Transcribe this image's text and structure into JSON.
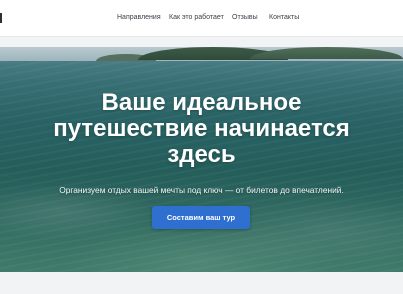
{
  "header": {
    "nav": [
      {
        "label": "Направления"
      },
      {
        "label": "Как это работает"
      },
      {
        "label": "Отзывы"
      },
      {
        "label": "Контакты"
      }
    ]
  },
  "hero": {
    "title_lines": [
      "Ваше идеальное",
      "путешествие начинается",
      "здесь"
    ],
    "subtitle": "Организуем отдых вашей мечты под ключ — от билетов до впечатлений.",
    "cta_label": "Составим ваш тур"
  },
  "colors": {
    "accent": "#2f6fd0",
    "hero_text": "#ffffff",
    "header_bg": "#ffffff",
    "page_bg": "#f2f3f4"
  }
}
